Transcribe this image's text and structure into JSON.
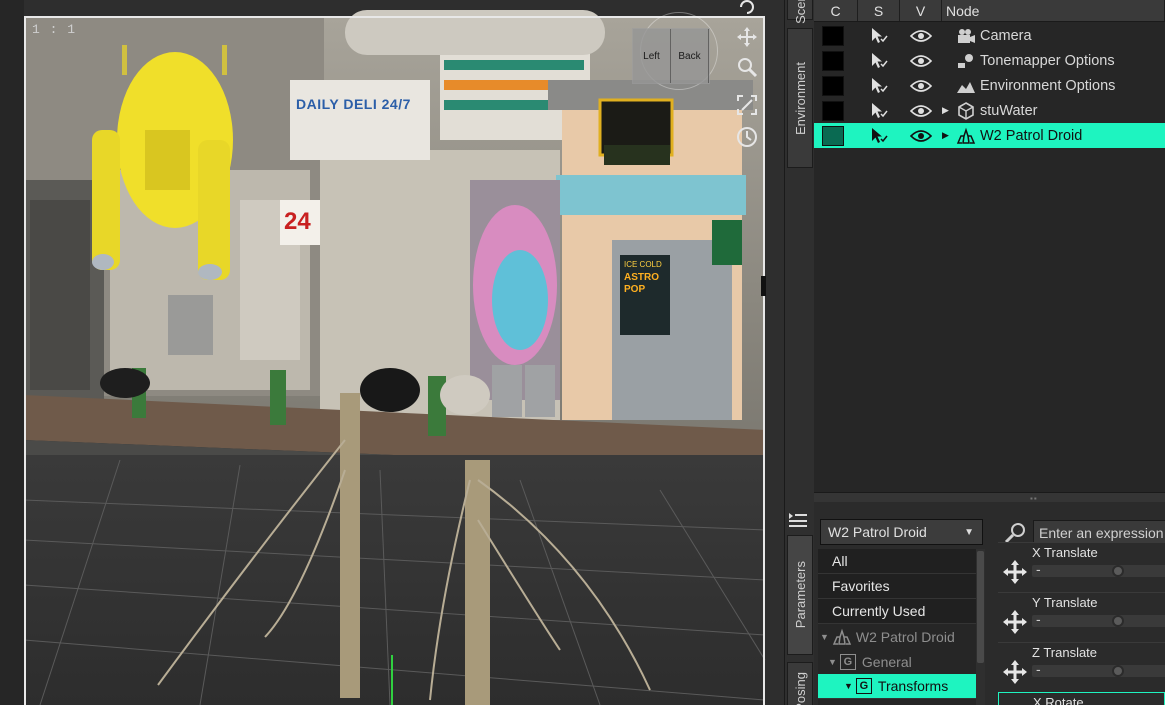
{
  "viewport": {
    "zoom_label": "1 : 1",
    "cube_faces": [
      "Left",
      "Back"
    ],
    "scene_signs": {
      "deli": "DAILY DELI 24/7",
      "number": "24",
      "poster_top": "ICE COLD",
      "poster_main": "ASTRO POP"
    }
  },
  "side_tabs": {
    "scene": "Scene",
    "environment": "Environment",
    "parameters": "Parameters",
    "posing": "Posing"
  },
  "scene_panel": {
    "columns": {
      "c": "C",
      "s": "S",
      "v": "V",
      "node": "Node"
    },
    "nodes": [
      {
        "label": "Camera",
        "icon": "camera-icon",
        "expandable": false,
        "selected": false
      },
      {
        "label": "Tonemapper Options",
        "icon": "tonemapper-icon",
        "expandable": false,
        "selected": false
      },
      {
        "label": "Environment Options",
        "icon": "environment-icon",
        "expandable": false,
        "selected": false
      },
      {
        "label": "stuWater",
        "icon": "cube-icon",
        "expandable": true,
        "selected": false
      },
      {
        "label": "W2 Patrol Droid",
        "icon": "figure-icon",
        "expandable": true,
        "selected": true
      }
    ]
  },
  "parameters_panel": {
    "node_select": "W2 Patrol Droid",
    "search_placeholder": "Enter an expression to filter",
    "filters": [
      {
        "label": "All"
      },
      {
        "label": "Favorites"
      },
      {
        "label": "Currently Used"
      }
    ],
    "tree": [
      {
        "label": "W2 Patrol Droid",
        "icon": "figure-icon",
        "dim": true
      },
      {
        "label": "General",
        "icon": "group-icon",
        "dim": true
      },
      {
        "label": "Transforms",
        "icon": "group-icon",
        "selected": true
      }
    ],
    "properties": [
      {
        "label": "X Translate",
        "value_text": "-"
      },
      {
        "label": "Y Translate",
        "value_text": "-"
      },
      {
        "label": "Z Translate",
        "value_text": "-"
      },
      {
        "label": "X Rotate",
        "value_text": "-"
      }
    ]
  },
  "colors": {
    "selection": "#1ef4c0",
    "panel_bg": "#262626",
    "droid_yellow": "#f0df2a"
  }
}
